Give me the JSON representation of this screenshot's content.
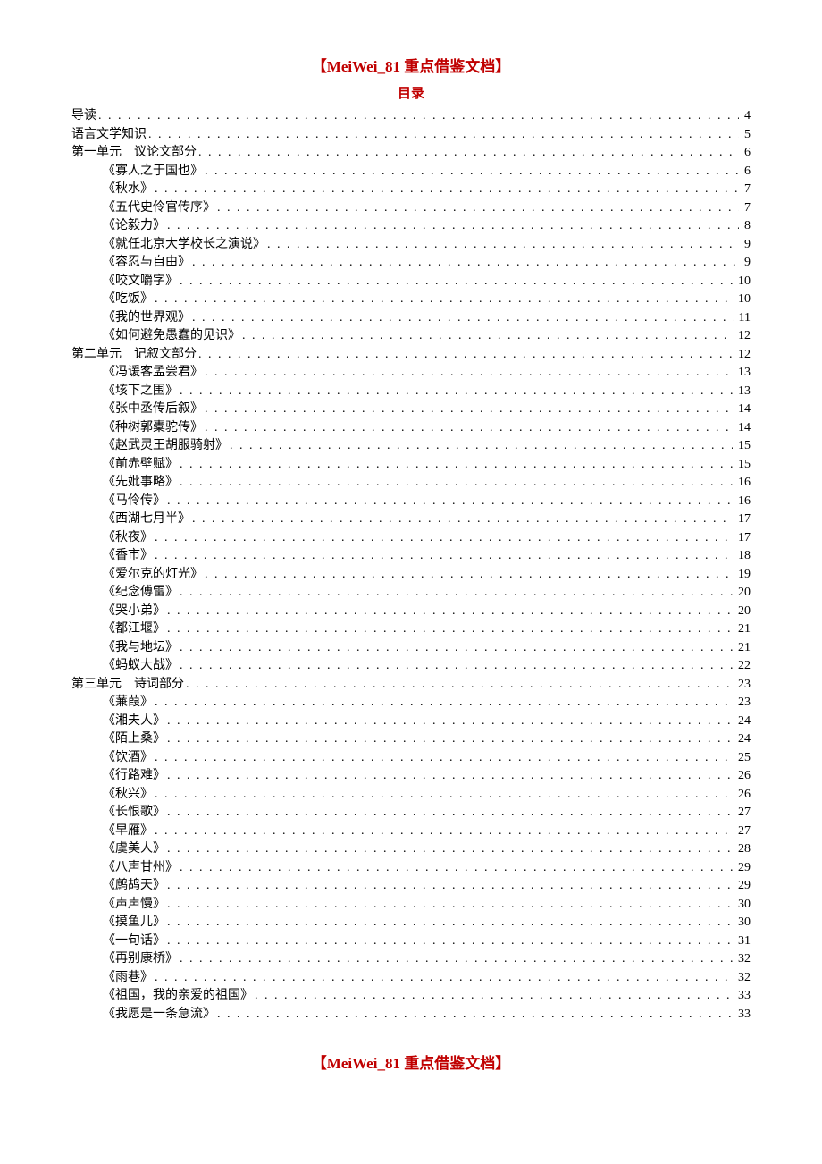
{
  "header": "【MeiWei_81 重点借鉴文档】",
  "footer": "【MeiWei_81 重点借鉴文档】",
  "toc_title": "目录",
  "toc": [
    {
      "level": 0,
      "label": "导读",
      "page": "4"
    },
    {
      "level": 0,
      "label": "语言文学知识",
      "page": "5"
    },
    {
      "level": 0,
      "label": "第一单元　议论文部分",
      "page": "6"
    },
    {
      "level": 1,
      "label": "《寡人之于国也》",
      "page": "6"
    },
    {
      "level": 1,
      "label": "《秋水》",
      "page": "7"
    },
    {
      "level": 1,
      "label": "《五代史伶官传序》",
      "page": "7"
    },
    {
      "level": 1,
      "label": "《论毅力》",
      "page": "8"
    },
    {
      "level": 1,
      "label": "《就任北京大学校长之演说》",
      "page": "9"
    },
    {
      "level": 1,
      "label": "《容忍与自由》",
      "page": "9"
    },
    {
      "level": 1,
      "label": "《咬文嚼字》",
      "page": "10"
    },
    {
      "level": 1,
      "label": "《吃饭》",
      "page": "10"
    },
    {
      "level": 1,
      "label": "《我的世界观》",
      "page": "11"
    },
    {
      "level": 1,
      "label": "《如何避免愚蠢的见识》",
      "page": "12"
    },
    {
      "level": 0,
      "label": "第二单元　记叙文部分",
      "page": "12"
    },
    {
      "level": 1,
      "label": "《冯谖客孟尝君》",
      "page": "13"
    },
    {
      "level": 1,
      "label": "《垓下之围》",
      "page": "13"
    },
    {
      "level": 1,
      "label": "《张中丞传后叙》",
      "page": "14"
    },
    {
      "level": 1,
      "label": "《种树郭橐驼传》",
      "page": "14"
    },
    {
      "level": 1,
      "label": "《赵武灵王胡服骑射》",
      "page": "15"
    },
    {
      "level": 1,
      "label": "《前赤壁赋》",
      "page": "15"
    },
    {
      "level": 1,
      "label": "《先妣事略》",
      "page": "16"
    },
    {
      "level": 1,
      "label": "《马伶传》",
      "page": "16"
    },
    {
      "level": 1,
      "label": "《西湖七月半》",
      "page": "17"
    },
    {
      "level": 1,
      "label": "《秋夜》",
      "page": "17"
    },
    {
      "level": 1,
      "label": "《香市》",
      "page": "18"
    },
    {
      "level": 1,
      "label": "《爱尔克的灯光》",
      "page": "19"
    },
    {
      "level": 1,
      "label": "《纪念傅雷》",
      "page": "20"
    },
    {
      "level": 1,
      "label": "《哭小弟》",
      "page": "20"
    },
    {
      "level": 1,
      "label": "《都江堰》",
      "page": "21"
    },
    {
      "level": 1,
      "label": "《我与地坛》",
      "page": "21"
    },
    {
      "level": 1,
      "label": "《蚂蚁大战》",
      "page": "22"
    },
    {
      "level": 0,
      "label": "第三单元　诗词部分",
      "page": "23"
    },
    {
      "level": 1,
      "label": "《蒹葭》",
      "page": "23"
    },
    {
      "level": 1,
      "label": "《湘夫人》",
      "page": "24"
    },
    {
      "level": 1,
      "label": "《陌上桑》",
      "page": "24"
    },
    {
      "level": 1,
      "label": "《饮酒》",
      "page": "25"
    },
    {
      "level": 1,
      "label": "《行路难》",
      "page": "26"
    },
    {
      "level": 1,
      "label": "《秋兴》",
      "page": "26"
    },
    {
      "level": 1,
      "label": "《长恨歌》",
      "page": "27"
    },
    {
      "level": 1,
      "label": "《早雁》",
      "page": "27"
    },
    {
      "level": 1,
      "label": "《虞美人》",
      "page": "28"
    },
    {
      "level": 1,
      "label": "《八声甘州》",
      "page": "29"
    },
    {
      "level": 1,
      "label": "《鹧鸪天》",
      "page": "29"
    },
    {
      "level": 1,
      "label": "《声声慢》",
      "page": "30"
    },
    {
      "level": 1,
      "label": "《摸鱼儿》",
      "page": "30"
    },
    {
      "level": 1,
      "label": "《一句话》",
      "page": "31"
    },
    {
      "level": 1,
      "label": "《再别康桥》",
      "page": "32"
    },
    {
      "level": 1,
      "label": "《雨巷》",
      "page": "32"
    },
    {
      "level": 1,
      "label": "《祖国，我的亲爱的祖国》",
      "page": "33"
    },
    {
      "level": 1,
      "label": "《我愿是一条急流》",
      "page": "33"
    }
  ]
}
